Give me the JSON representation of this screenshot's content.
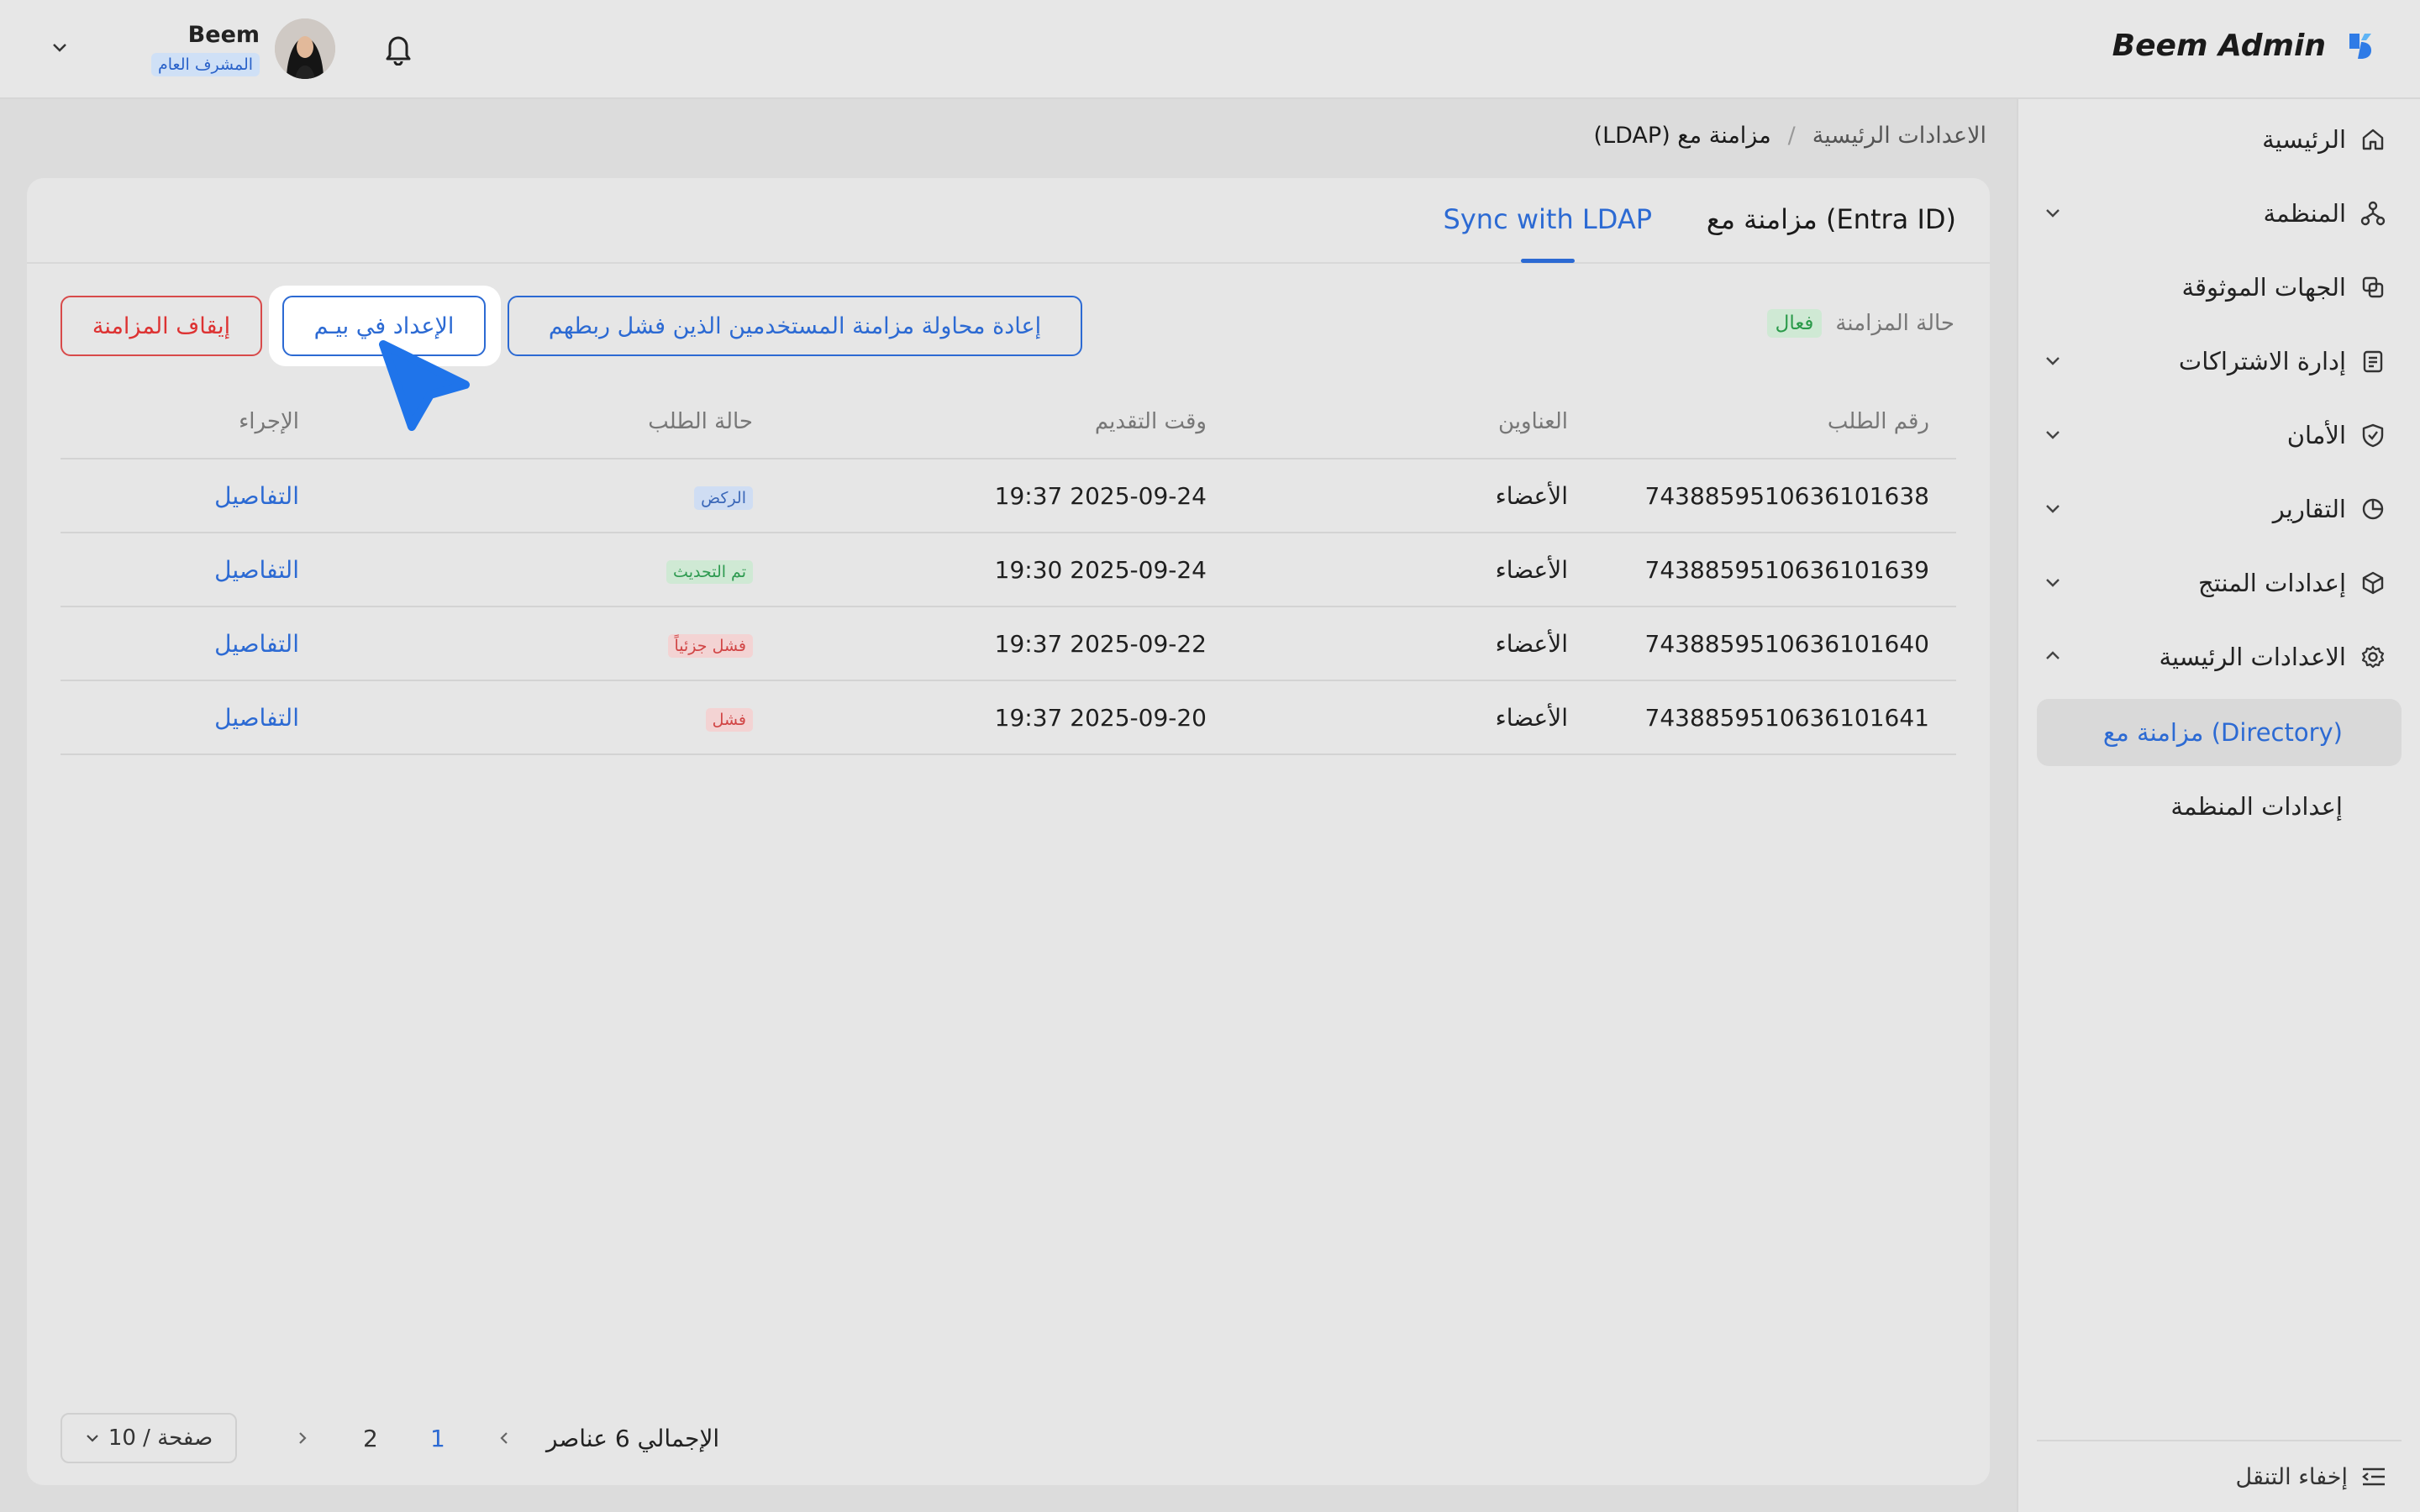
{
  "header": {
    "brand_title": "Beem Admin",
    "user_name": "Beem",
    "user_role": "المشرف العام"
  },
  "sidebar": {
    "items": [
      {
        "label": "الرئيسية"
      },
      {
        "label": "المنظمة"
      },
      {
        "label": "الجهات الموثوقة"
      },
      {
        "label": "إدارة الاشتراكات"
      },
      {
        "label": "الأمان"
      },
      {
        "label": "التقارير"
      },
      {
        "label": "إعدادات المنتج"
      },
      {
        "label": "الاعدادات الرئيسية"
      }
    ],
    "sub_items": [
      {
        "label": "مزامنة مع (Directory)",
        "active": true
      },
      {
        "label": "إعدادات المنظمة",
        "active": false
      }
    ],
    "hide_nav": "إخفاء التنقل"
  },
  "breadcrumb": {
    "parent": "الاعدادات الرئيسية",
    "separator": "/",
    "current": "مزامنة مع (LDAP)"
  },
  "tabs": {
    "entra": "مزامنة مع (Entra ID)",
    "ldap": "Sync with LDAP",
    "active": "ldap"
  },
  "sync_status": {
    "label": "حالة المزامنة",
    "value": "فعال",
    "color": "#2b9a4a"
  },
  "actions": {
    "retry": "إعادة محاولة مزامنة المستخدمين الذين فشل ربطهم",
    "setup": "الإعداد في بيـم",
    "stop": "إيقاف المزامنة"
  },
  "table": {
    "headers": {
      "id": "رقم الطلب",
      "addresses": "العناوين",
      "submitted": "وقت التقديم",
      "state": "حالة الطلب",
      "action": "الإجراء"
    },
    "rows": [
      {
        "id": "7438859510636101638",
        "addresses": "الأعضاء",
        "submitted": "2025-09-24 19:37",
        "state": "الركض",
        "state_color": "blue",
        "action": "التفاصيل"
      },
      {
        "id": "7438859510636101639",
        "addresses": "الأعضاء",
        "submitted": "2025-09-24 19:30",
        "state": "تم التحديث",
        "state_color": "green",
        "action": "التفاصيل"
      },
      {
        "id": "7438859510636101640",
        "addresses": "الأعضاء",
        "submitted": "2025-09-22 19:37",
        "state": "فشل جزئياً",
        "state_color": "red",
        "action": "التفاصيل"
      },
      {
        "id": "7438859510636101641",
        "addresses": "الأعضاء",
        "submitted": "2025-09-20 19:37",
        "state": "فشل",
        "state_color": "red",
        "action": "التفاصيل"
      }
    ]
  },
  "pagination": {
    "total": "الإجمالي 6 عناصر",
    "pages": [
      "1",
      "2"
    ],
    "current_page": "1",
    "page_size": "10 / صفحة"
  },
  "colors": {
    "accent": "#2c6ad3",
    "danger": "#d84a4a"
  }
}
